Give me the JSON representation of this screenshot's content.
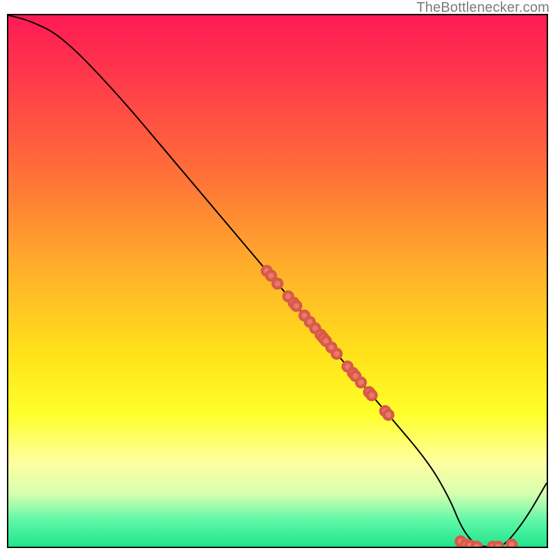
{
  "attribution": "TheBottlenecker.com",
  "colors": {
    "gradient_top": "#ff1a55",
    "gradient_mid": "#ffe31a",
    "gradient_bottom": "#20e58c",
    "marker_fill": "#e87a6a",
    "marker_stroke": "#d85a4a",
    "curve": "#000000"
  },
  "chart_data": {
    "type": "line",
    "title": "",
    "xlabel": "",
    "ylabel": "",
    "xlim": [
      0,
      100
    ],
    "ylim": [
      0,
      100
    ],
    "series": [
      {
        "name": "bottleneck-curve",
        "kind": "line",
        "x": [
          0,
          4,
          10,
          20,
          30,
          40,
          50,
          60,
          70,
          78,
          82,
          84,
          86,
          88,
          90,
          92,
          96,
          100
        ],
        "y": [
          100,
          99,
          96,
          85.5,
          73.5,
          61.5,
          49.5,
          37.5,
          25.5,
          16,
          9,
          4,
          1,
          0,
          0,
          0,
          5,
          12
        ]
      },
      {
        "name": "diagonal-cluster",
        "kind": "scatter",
        "x": [
          48,
          48.8,
          50,
          52,
          53,
          53.5,
          55,
          56,
          57,
          58,
          58.5,
          59,
          60,
          61,
          63,
          64,
          64.5,
          65.5,
          67,
          67.5,
          70,
          70.6
        ],
        "y": [
          51.9,
          51.0,
          49.5,
          47.1,
          45.9,
          45.3,
          43.5,
          42.3,
          41.1,
          39.9,
          39.3,
          38.7,
          37.5,
          36.3,
          33.9,
          32.7,
          32.1,
          30.9,
          29.1,
          28.5,
          25.5,
          24.8
        ]
      },
      {
        "name": "bottom-cluster",
        "kind": "scatter",
        "x": [
          84,
          85,
          85.8,
          87,
          90,
          91,
          93.5
        ],
        "y": [
          1.0,
          0.4,
          0.2,
          0.0,
          0.0,
          0.0,
          0.4
        ]
      }
    ]
  }
}
